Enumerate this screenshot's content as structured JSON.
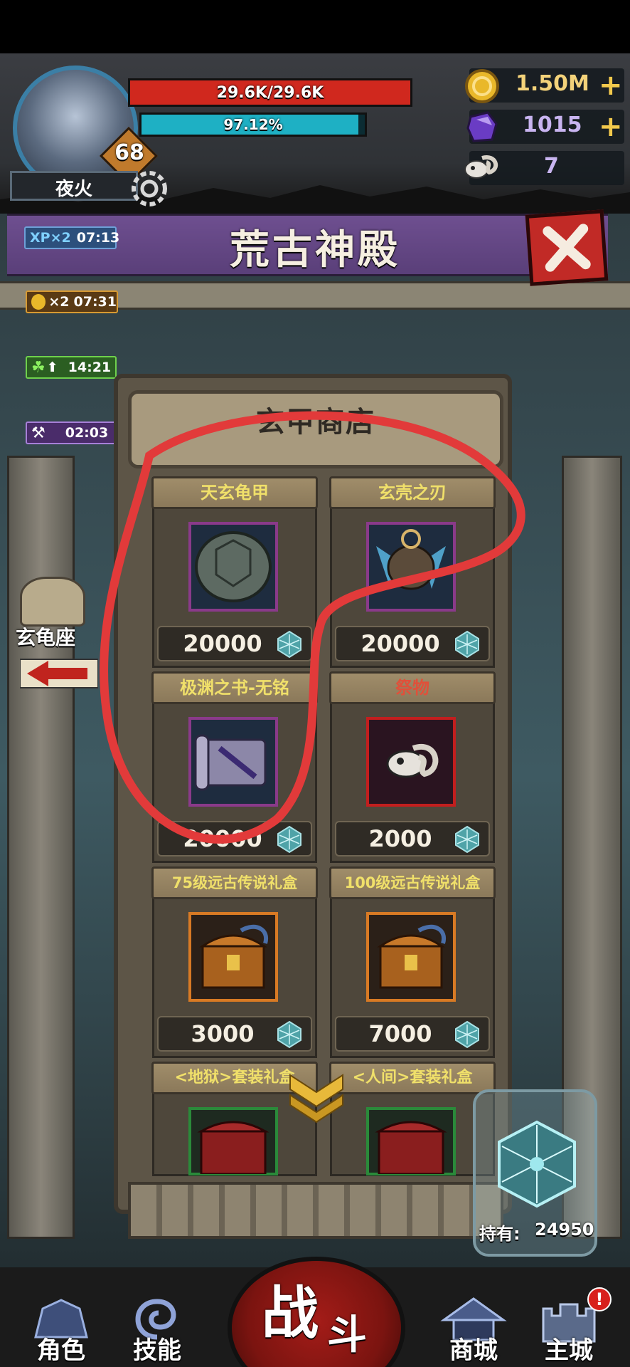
{
  "player": {
    "name": "夜火",
    "level": "68",
    "hp_text": "29.6K/29.6K",
    "xp_text": "97.12%",
    "xp_progress": 0.9712
  },
  "resources": {
    "gold": "1.50M",
    "gems": "1015",
    "skulls": "7"
  },
  "boosts": [
    {
      "label": "XP×2",
      "time": "07:13"
    },
    {
      "label": "×2",
      "time": "07:31"
    },
    {
      "label": "",
      "time": "14:21"
    },
    {
      "label": "",
      "time": "02:03"
    }
  ],
  "header": {
    "title": "荒古神殿"
  },
  "shop": {
    "title": "玄甲商店",
    "items": [
      {
        "name": "天玄龟甲",
        "price": "20000",
        "frame": "purple"
      },
      {
        "name": "玄壳之刃",
        "price": "20000",
        "frame": "purple"
      },
      {
        "name": "极渊之书-无铭",
        "price": "20000",
        "frame": "purple"
      },
      {
        "name": "祭物",
        "price": "2000",
        "frame": "red"
      },
      {
        "name": "75级远古传说礼盒",
        "price": "3000",
        "frame": "orange"
      },
      {
        "name": "100级远古传说礼盒",
        "price": "7000",
        "frame": "orange"
      },
      {
        "name": "<地狱>套装礼盒",
        "price": "",
        "frame": "green"
      },
      {
        "name": "<人间>套装礼盒",
        "price": "",
        "frame": "green"
      }
    ]
  },
  "side": {
    "constellation": "玄龟座"
  },
  "holding": {
    "label": "持有:",
    "value": "24950"
  },
  "nav": {
    "character": "角色",
    "skills": "技能",
    "fight_1": "战",
    "fight_2": "斗",
    "shop": "商城",
    "main_city": "主城",
    "alert": "!"
  },
  "colors": {
    "hp": "#d0281e",
    "xp": "#1eb0c4",
    "banner": "#6b4b8c",
    "gold_text": "#f3d27a"
  }
}
